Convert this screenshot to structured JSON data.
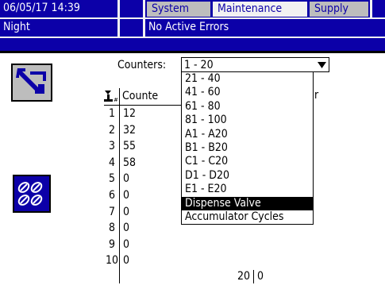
{
  "status_bar": {
    "datetime": "06/05/17 14:39",
    "mode": "Night",
    "errors": "No Active Errors"
  },
  "tabs": [
    {
      "label": "System",
      "active": false
    },
    {
      "label": "Maintenance",
      "active": true
    },
    {
      "label": "Supply",
      "active": false
    }
  ],
  "counters": {
    "label": "Counters:",
    "selected": "1 - 20",
    "options": [
      "21 - 40",
      "41 - 60",
      "61 - 80",
      "81 - 100",
      "A1 - A20",
      "B1 - B20",
      "C1 - C20",
      "D1 - D20",
      "E1 - E20",
      "Dispense Valve",
      "Accumulator Cycles"
    ],
    "highlighted_option": "Dispense Valve"
  },
  "table": {
    "col_counter_header": "Counte",
    "col_right_header": "r",
    "rows": [
      {
        "num": "1",
        "val": "12"
      },
      {
        "num": "2",
        "val": "32"
      },
      {
        "num": "3",
        "val": "55"
      },
      {
        "num": "4",
        "val": "58"
      },
      {
        "num": "5",
        "val": "0"
      },
      {
        "num": "6",
        "val": "0"
      },
      {
        "num": "7",
        "val": "0"
      },
      {
        "num": "8",
        "val": "0"
      },
      {
        "num": "9",
        "val": "0"
      },
      {
        "num": "10",
        "val": "0"
      }
    ],
    "right_rows": [
      {
        "num": "20",
        "val": "0"
      }
    ]
  },
  "colors": {
    "header_blue": "#0c00a8",
    "tab_grey": "#bdbdbd",
    "button_grey": "#bdbdbd"
  },
  "icons": [
    "exit-screen-icon",
    "linked-valves-icon",
    "valve-counter-icon",
    "dropdown-arrow-icon"
  ]
}
